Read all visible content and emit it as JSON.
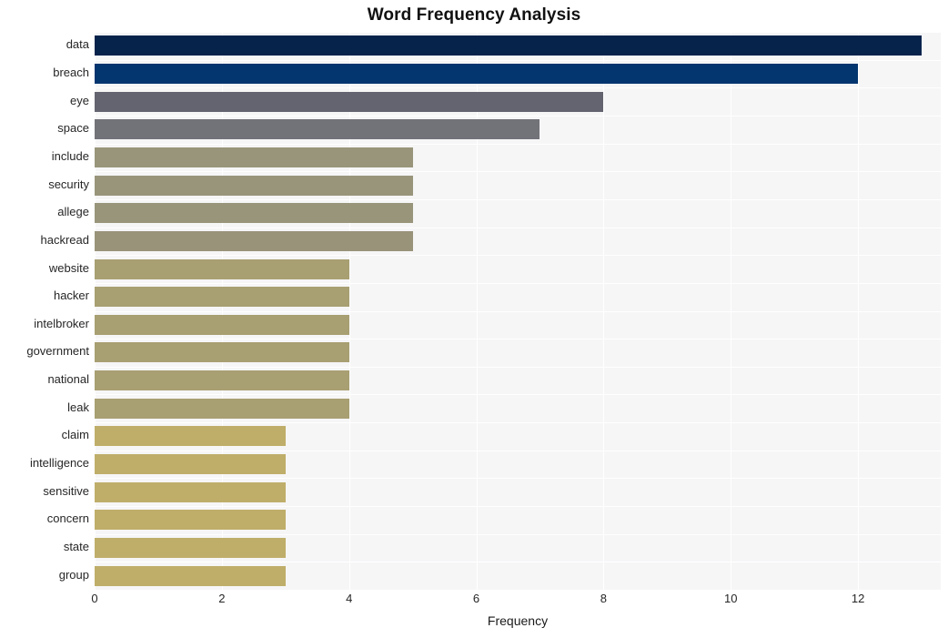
{
  "chart_data": {
    "type": "bar",
    "orientation": "horizontal",
    "title": "Word Frequency Analysis",
    "xlabel": "Frequency",
    "ylabel": "",
    "xlim": [
      0,
      13.3
    ],
    "xticks": [
      0,
      2,
      4,
      6,
      8,
      10,
      12
    ],
    "xtick_labels": [
      "0",
      "2",
      "4",
      "6",
      "8",
      "10",
      "12"
    ],
    "grid": true,
    "grid_color": "#ffffff",
    "plot_background": "#f6f6f7",
    "figure_background": "#ffffff",
    "legend": null,
    "categories": [
      "data",
      "breach",
      "eye",
      "space",
      "include",
      "security",
      "allege",
      "hackread",
      "website",
      "hacker",
      "intelbroker",
      "government",
      "national",
      "leak",
      "claim",
      "intelligence",
      "sensitive",
      "concern",
      "state",
      "group"
    ],
    "values": [
      13,
      12,
      8,
      7,
      5,
      5,
      5,
      5,
      4,
      4,
      4,
      4,
      4,
      4,
      3,
      3,
      3,
      3,
      3,
      3
    ],
    "bar_colors": [
      "#06234c",
      "#03356f",
      "#63646f",
      "#727279",
      "#99957b",
      "#99957b",
      "#99957b",
      "#99937a",
      "#a89f72",
      "#a89f72",
      "#a89f72",
      "#a89f72",
      "#a89f72",
      "#a89f72",
      "#bfae6a",
      "#bfae6a",
      "#bfae6a",
      "#bfae6a",
      "#bfae6a",
      "#bfae6a"
    ]
  },
  "axis": {
    "x_label": "Frequency"
  }
}
